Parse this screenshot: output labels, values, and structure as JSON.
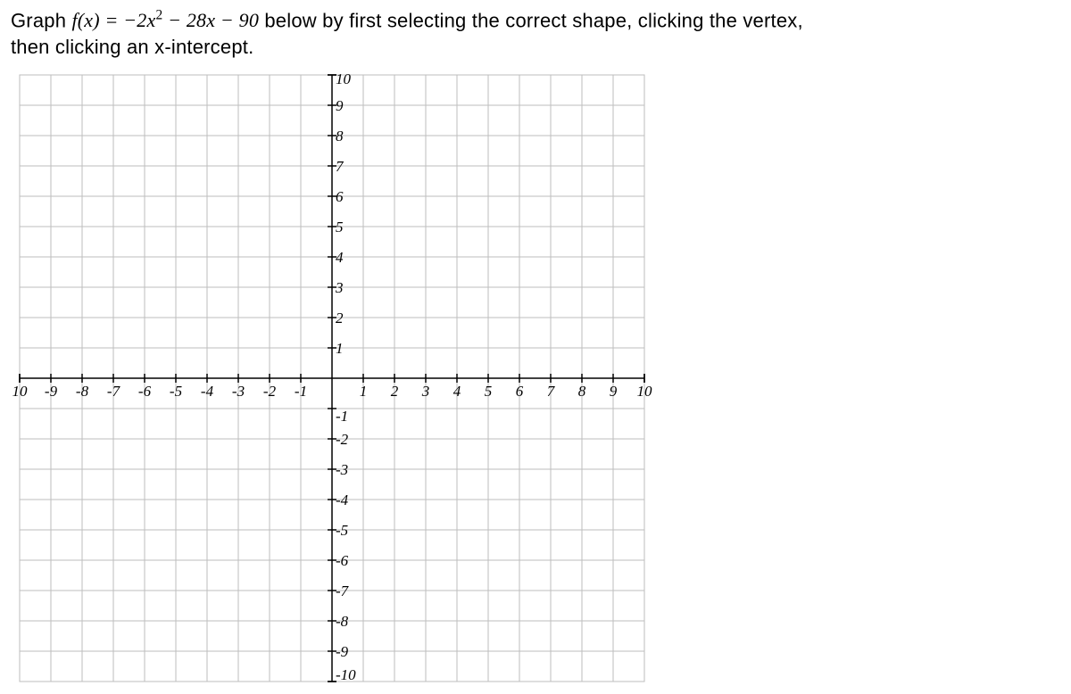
{
  "prompt": {
    "prefix": "Graph ",
    "fx": "f(x) = ",
    "neg2x2": "−2x",
    "sup2": "2",
    "minus28x": " − 28x",
    "minus90": " − 90",
    "after": " below by first selecting the correct shape, clicking the vertex,",
    "line2": "then clicking an x-intercept."
  },
  "chart_data": {
    "type": "scatter",
    "title": "",
    "xlabel": "",
    "ylabel": "",
    "xlim": [
      -10,
      10
    ],
    "ylim": [
      -10,
      10
    ],
    "x_ticks": [
      -10,
      -9,
      -8,
      -7,
      -6,
      -5,
      -4,
      -3,
      -2,
      -1,
      1,
      2,
      3,
      4,
      5,
      6,
      7,
      8,
      9,
      10
    ],
    "y_ticks": [
      -10,
      -9,
      -8,
      -7,
      -6,
      -5,
      -4,
      -3,
      -2,
      -1,
      1,
      2,
      3,
      4,
      5,
      6,
      7,
      8,
      9,
      10
    ],
    "x_tick_labels": {
      "-10": "10",
      "-9": "-9",
      "-8": "-8",
      "-7": "-7",
      "-6": "-6",
      "-5": "-5",
      "-4": "-4",
      "-3": "-3",
      "-2": "-2",
      "-1": "-1",
      "1": "1",
      "2": "2",
      "3": "3",
      "4": "4",
      "5": "5",
      "6": "6",
      "7": "7",
      "8": "8",
      "9": "9",
      "10": "10"
    },
    "y_tick_labels": {
      "-10": "-10",
      "-9": "-9",
      "-8": "-8",
      "-7": "-7",
      "-6": "-6",
      "-5": "-5",
      "-4": "-4",
      "-3": "-3",
      "-2": "-2",
      "-1": "-1",
      "1": "1",
      "2": "2",
      "3": "3",
      "4": "4",
      "5": "5",
      "6": "6",
      "7": "7",
      "8": "8",
      "9": "9",
      "10": "10"
    },
    "series": []
  }
}
